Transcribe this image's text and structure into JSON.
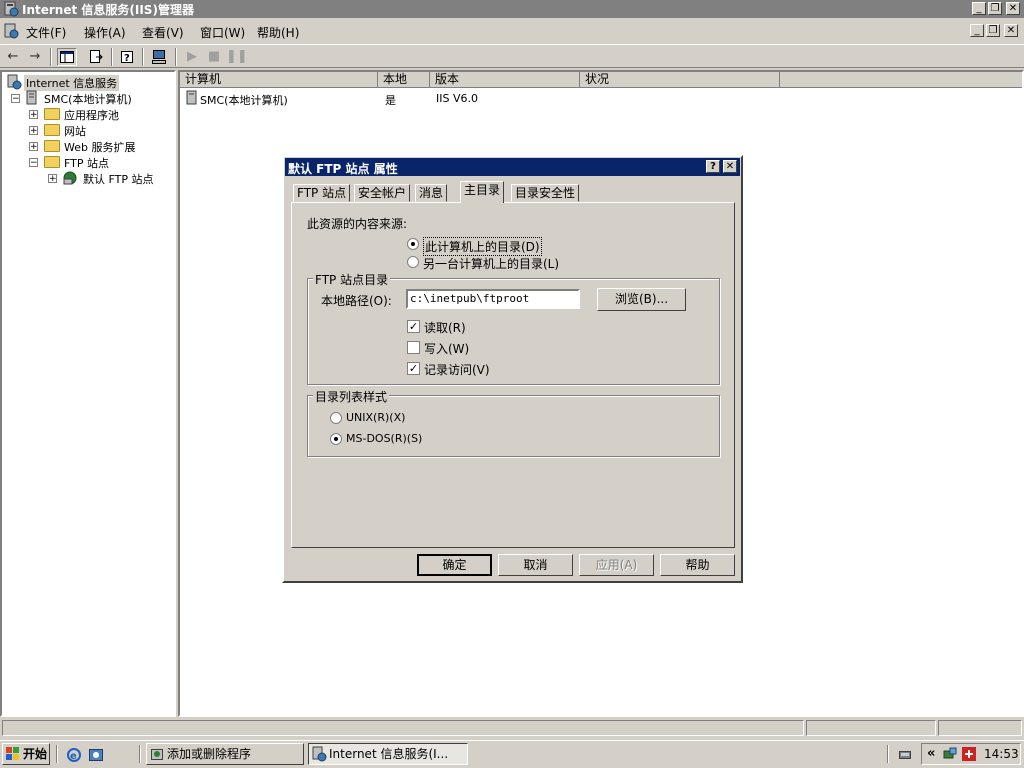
{
  "window": {
    "title": "Internet 信息服务(IIS)管理器",
    "controls": {
      "minimize": "_",
      "restore": "❐",
      "close": "✕"
    }
  },
  "menu": [
    "文件(F)",
    "操作(A)",
    "查看(V)",
    "窗口(W)",
    "帮助(H)"
  ],
  "toolbar": {
    "icons": [
      "back-icon",
      "forward-icon",
      "show-hide-tree-icon",
      "export-list-icon",
      "help-icon",
      "computer-icon",
      "play-icon",
      "stop-icon",
      "pause-icon"
    ]
  },
  "tree": {
    "root": "Internet 信息服务",
    "computer": "SMC(本地计算机)",
    "children": [
      "应用程序池",
      "网站",
      "Web 服务扩展",
      "FTP 站点"
    ],
    "ftp_child": "默认 FTP 站点"
  },
  "list": {
    "columns": [
      "计算机",
      "本地",
      "版本",
      "状况"
    ],
    "rows": [
      {
        "computer": "SMC(本地计算机)",
        "local": "是",
        "version": "IIS V6.0",
        "status": ""
      }
    ]
  },
  "dialog": {
    "title": "默认 FTP 站点 属性",
    "help_btn": "?",
    "close_btn": "✕",
    "tabs": [
      "FTP 站点",
      "安全帐户",
      "消息",
      "主目录",
      "目录安全性"
    ],
    "active_tab": "主目录",
    "content_source_label": "此资源的内容来源:",
    "radio_this_computer": "此计算机上的目录(D)",
    "radio_other_computer": "另一台计算机上的目录(L)",
    "ftp_dir_group": "FTP 站点目录",
    "local_path_label": "本地路径(O):",
    "local_path_value": "c:\\inetpub\\ftproot",
    "browse_btn": "浏览(B)...",
    "chk_read": "读取(R)",
    "chk_write": "写入(W)",
    "chk_log": "记录访问(V)",
    "listing_group": "目录列表样式",
    "radio_unix": "UNIX(R)(X)",
    "radio_msdos": "MS-DOS(R)(S)",
    "ok": "确定",
    "cancel": "取消",
    "apply": "应用(A)",
    "help": "帮助",
    "state": {
      "this_computer": true,
      "read": true,
      "write": false,
      "log": true,
      "msdos": true
    }
  },
  "taskbar": {
    "start": "开始",
    "tasks": [
      "添加或删除程序",
      "Internet 信息服务(I..."
    ],
    "tray_arrows": "«",
    "clock": "14:53"
  }
}
